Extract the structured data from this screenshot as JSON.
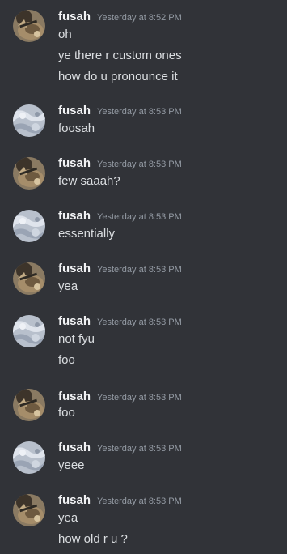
{
  "messages": [
    {
      "author": "fusah",
      "time": "Yesterday at 8:52 PM",
      "avatar": "cat-avatar-icon",
      "lines": [
        "oh",
        "ye there r custom ones",
        "how do u pronounce it"
      ]
    },
    {
      "author": "fusah",
      "time": "Yesterday at 8:53 PM",
      "avatar": "crystal-avatar-icon",
      "lines": [
        "foosah"
      ]
    },
    {
      "author": "fusah",
      "time": "Yesterday at 8:53 PM",
      "avatar": "cat-avatar-icon",
      "lines": [
        "few saaah?"
      ]
    },
    {
      "author": "fusah",
      "time": "Yesterday at 8:53 PM",
      "avatar": "crystal-avatar-icon",
      "lines": [
        "essentially"
      ]
    },
    {
      "author": "fusah",
      "time": "Yesterday at 8:53 PM",
      "avatar": "cat-avatar-icon",
      "lines": [
        "yea"
      ]
    },
    {
      "author": "fusah",
      "time": "Yesterday at 8:53 PM",
      "avatar": "crystal-avatar-icon",
      "lines": [
        "not fyu",
        "foo"
      ]
    },
    {
      "author": "fusah",
      "time": "Yesterday at 8:53 PM",
      "avatar": "cat-avatar-icon",
      "lines": [
        "foo"
      ]
    },
    {
      "author": "fusah",
      "time": "Yesterday at 8:53 PM",
      "avatar": "crystal-avatar-icon",
      "lines": [
        "yeee"
      ]
    },
    {
      "author": "fusah",
      "time": "Yesterday at 8:53 PM",
      "avatar": "cat-avatar-icon",
      "lines": [
        "yea",
        "how old r u ?"
      ]
    }
  ],
  "colors": {
    "background": "#313338",
    "username": "#f2f3f5",
    "timestamp": "#949ba4",
    "text": "#dbdee1"
  }
}
